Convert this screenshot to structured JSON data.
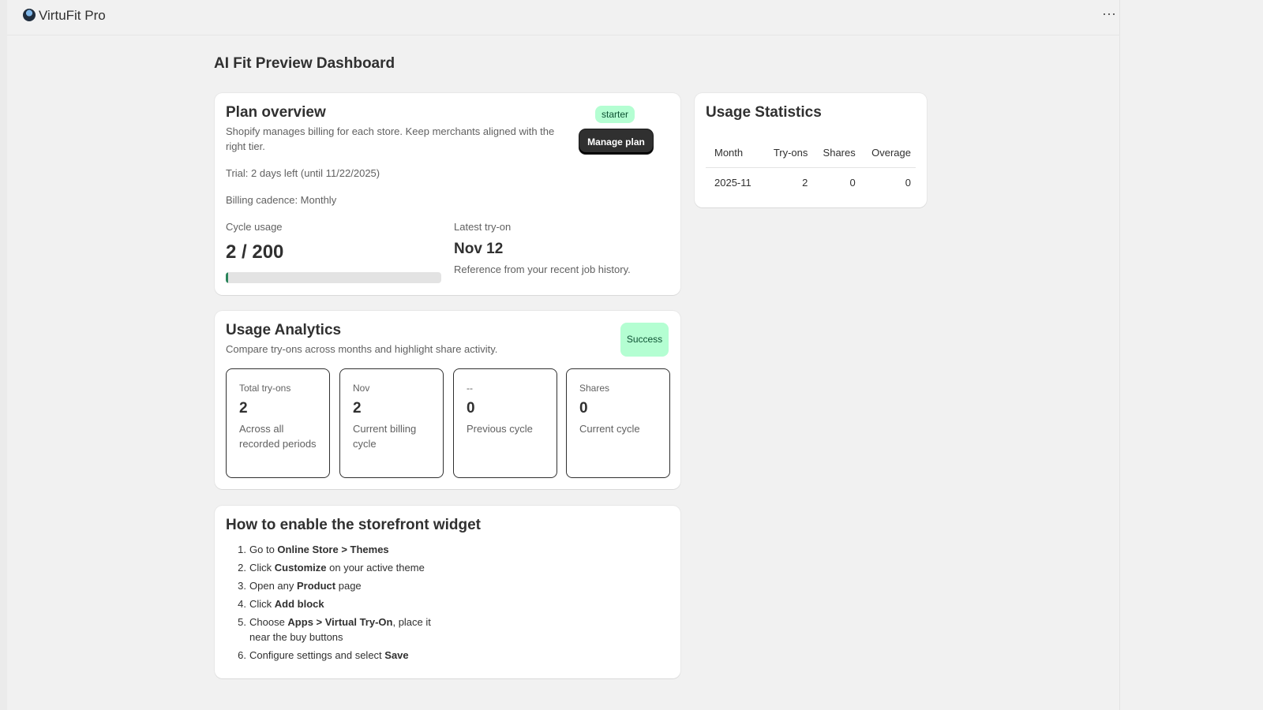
{
  "app": {
    "title": "VirtuFit Pro",
    "menu_icon": "ellipsis-icon",
    "menu_glyph": "···"
  },
  "page": {
    "title": "AI Fit Preview Dashboard"
  },
  "plan": {
    "title": "Plan overview",
    "description": "Shopify manages billing for each store. Keep merchants aligned with the right tier.",
    "badge": "starter",
    "manage_button": "Manage plan",
    "trial": "Trial: 2 days left (until 11/22/2025)",
    "billing": "Billing cadence: Monthly",
    "cycle_label": "Cycle usage",
    "cycle_value": "2 / 200",
    "cycle_progress_fraction": 0.01,
    "latest_label": "Latest try-on",
    "latest_value": "Nov 12",
    "latest_desc": "Reference from your recent job history."
  },
  "analytics": {
    "title": "Usage Analytics",
    "description": "Compare try-ons across months and highlight share activity.",
    "badge": "Success",
    "stats": [
      {
        "label": "Total try-ons",
        "value": "2",
        "sub": "Across all recorded periods"
      },
      {
        "label": "Nov",
        "value": "2",
        "sub": "Current billing cycle"
      },
      {
        "label": "--",
        "value": "0",
        "sub": "Previous cycle"
      },
      {
        "label": "Shares",
        "value": "0",
        "sub": "Current cycle"
      }
    ]
  },
  "widget": {
    "title": "How to enable the storefront widget",
    "steps": [
      {
        "num": "1.",
        "pre": "Go to ",
        "bold": "Online Store > Themes",
        "post": ""
      },
      {
        "num": "2.",
        "pre": "Click ",
        "bold": "Customize",
        "post": " on your active theme"
      },
      {
        "num": "3.",
        "pre": "Open any ",
        "bold": "Product",
        "post": " page"
      },
      {
        "num": "4.",
        "pre": "Click ",
        "bold": "Add block",
        "post": ""
      },
      {
        "num": "5.",
        "pre": "Choose ",
        "bold": "Apps > Virtual Try-On",
        "post": ", place it near the buy buttons"
      },
      {
        "num": "6.",
        "pre": "Configure settings and select ",
        "bold": "Save",
        "post": ""
      }
    ]
  },
  "usage_stats": {
    "title": "Usage Statistics",
    "columns": [
      "Month",
      "Try-ons",
      "Shares",
      "Overage"
    ],
    "rows": [
      [
        "2025-11",
        "2",
        "0",
        "0"
      ]
    ]
  },
  "colors": {
    "accent_dark": "#303030",
    "success_bg": "#b4fed2",
    "progress": "#29845a"
  }
}
